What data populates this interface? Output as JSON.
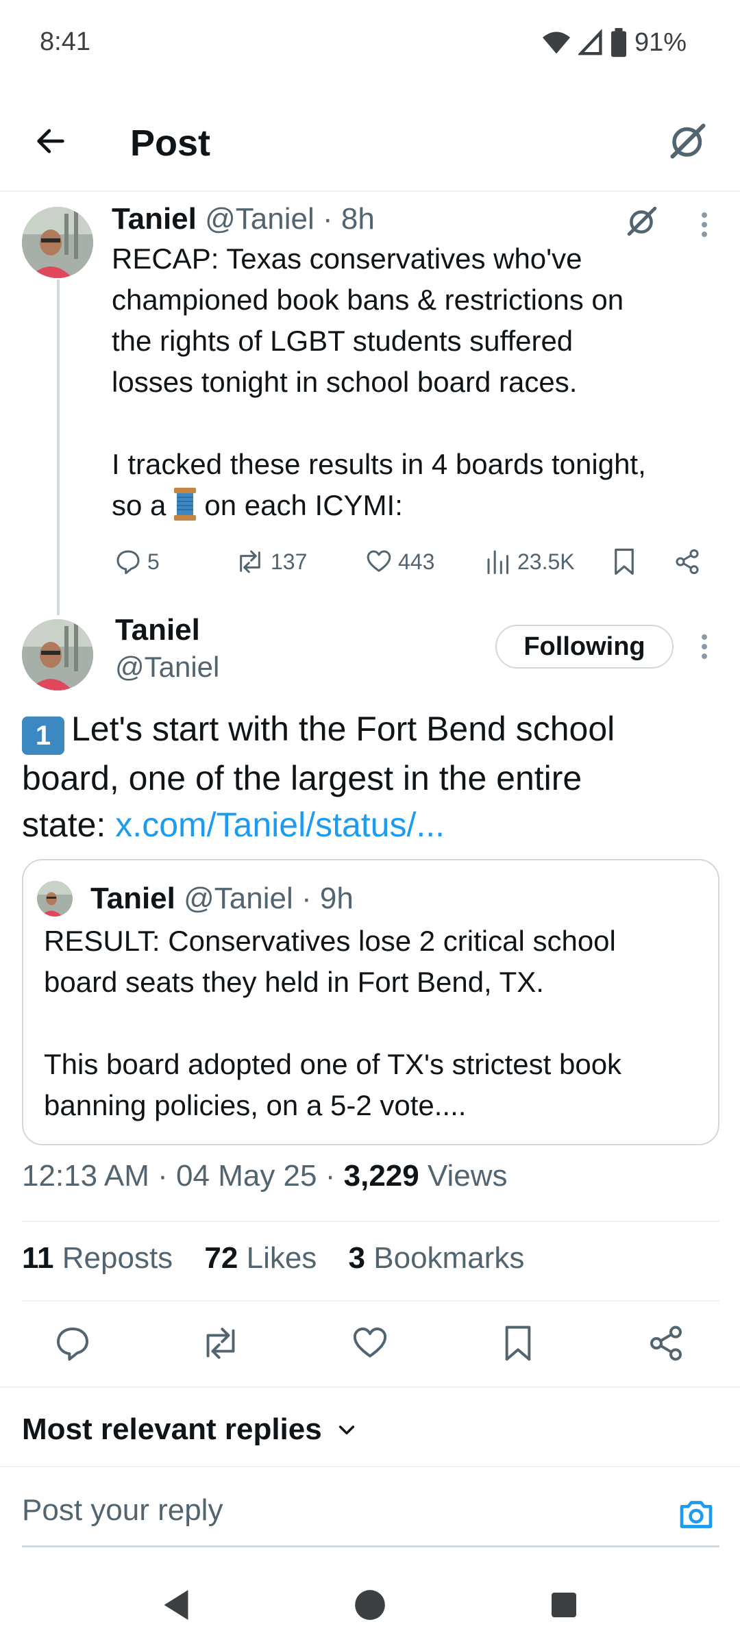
{
  "status_bar": {
    "time": "8:41",
    "battery": "91%"
  },
  "header": {
    "title": "Post"
  },
  "parent_post": {
    "name": "Taniel",
    "handle": "@Taniel",
    "time": "8h",
    "text_lines": [
      "RECAP: Texas conservatives who've",
      "championed book bans & restrictions on",
      "the rights of LGBT students suffered",
      "losses tonight in school board races."
    ],
    "text2_line1": "I tracked these results in 4 boards tonight,",
    "text2_before_emoji": "so a",
    "text2_after_emoji": "on each ICYMI:",
    "replies": "5",
    "reposts": "137",
    "likes": "443",
    "views": "23.5K"
  },
  "main_post": {
    "name": "Taniel",
    "handle": "@Taniel",
    "follow_label": "Following",
    "keycap": "1",
    "text_line1": "Let's start with the Fort Bend school",
    "text_line2": "board, one of the largest in the entire",
    "text_line3": "state:",
    "link": "x.com/Taniel/status/...",
    "quote": {
      "name": "Taniel",
      "handle": "@Taniel",
      "time": "9h",
      "lines": [
        "RESULT: Conservatives lose 2 critical school",
        "board seats they held in Fort Bend, TX.",
        "",
        "This board adopted one of TX's strictest book",
        "banning policies, on a 5-2 vote...."
      ]
    },
    "meta_time": "12:13 AM",
    "meta_date": "04 May 25",
    "views_count": "3,229",
    "views_label": "Views",
    "reposts_count": "11",
    "reposts_label": "Reposts",
    "likes_count": "72",
    "likes_label": "Likes",
    "bookmarks_count": "3",
    "bookmarks_label": "Bookmarks"
  },
  "replies_sort": "Most relevant replies",
  "reply_placeholder": "Post your reply",
  "colors": {
    "link": "#1d9bf0",
    "text": "#0f1419",
    "muted": "#536471",
    "border": "#cfd9de"
  }
}
